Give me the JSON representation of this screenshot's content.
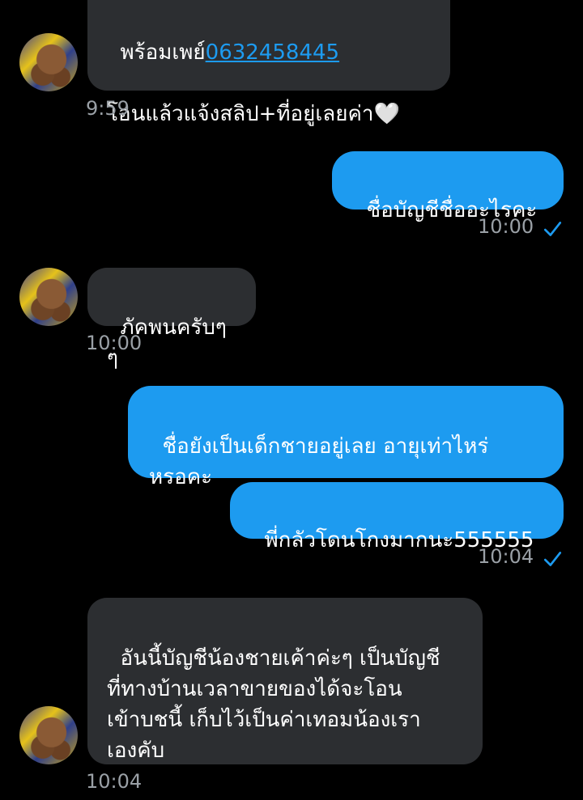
{
  "messages": [
    {
      "side": "in",
      "line1_prefix": "พร้อมเพย์",
      "line1_link": "0632458445",
      "line2": "โอนแล้วแจ้งสลิป+ที่อยู่เลยค่า🤍",
      "time": "9:59"
    },
    {
      "side": "out",
      "text": "ชื่อบัญชีชื่ออะไรคะ",
      "time": "10:00"
    },
    {
      "side": "in",
      "text": "ภัคพนครับๆๆ",
      "time": "10:00"
    },
    {
      "side": "out",
      "text": "ชื่อยังเป็นเด็กชายอยู่เลย อายุเท่าไหร่\nหรอคะ"
    },
    {
      "side": "out",
      "text": "พี่กลัวโดนโกงมากนะ555555",
      "time": "10:04"
    },
    {
      "side": "in",
      "text": "อันนี้บัญชีน้องชายเค้าค่ะๆ เป็นบัญชี\nที่ทางบ้านเวลาขายของได้จะโอน\nเข้าบชนี้ เก็บไว้เป็นค่าเทอมน้องเรา\nเองคับ",
      "time": "10:04"
    }
  ],
  "colors": {
    "incoming_bubble": "#2c2e31",
    "outgoing_bubble": "#1d9bf0",
    "link": "#1d9bf0",
    "background": "#000000"
  },
  "icons": {
    "read_receipt": "checkmark-icon",
    "avatar": "bear-avatar"
  }
}
